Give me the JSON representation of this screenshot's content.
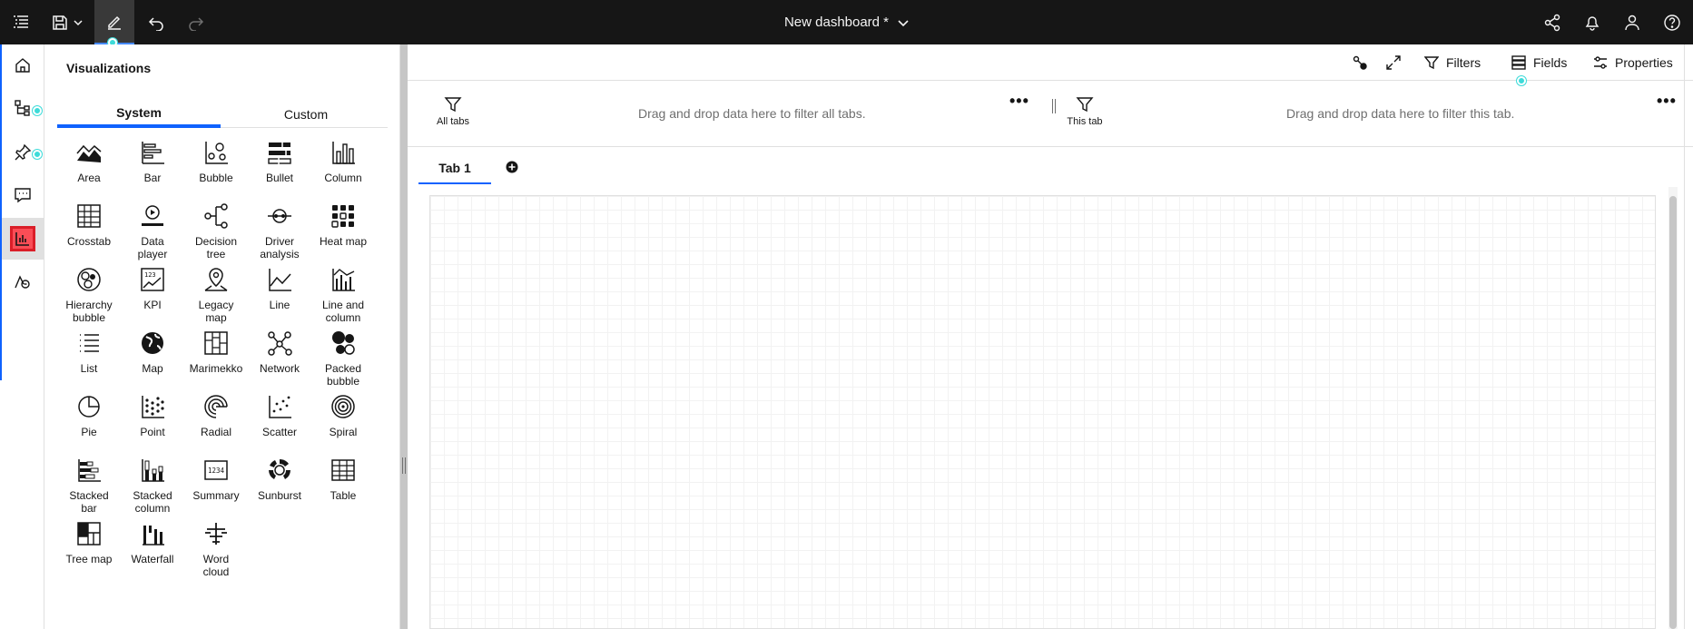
{
  "colors": {
    "topbar": "#161616",
    "accent": "#0f62fe",
    "teal_dot": "#3ddbd9",
    "highlight": "#da1e28"
  },
  "header": {
    "title": "New dashboard *",
    "icons": [
      "menu-icon",
      "save-icon",
      "chevron-down-icon",
      "edit-icon",
      "undo-icon",
      "redo-icon",
      "share-icon",
      "notification-icon",
      "user-icon",
      "help-icon"
    ]
  },
  "rail": {
    "items": [
      "home-icon",
      "data-sources-icon",
      "pin-icon",
      "comments-icon",
      "visualizations-icon",
      "assistant-icon"
    ]
  },
  "panel": {
    "title": "Visualizations",
    "tabs": [
      "System",
      "Custom"
    ],
    "active_tab": "System",
    "items": [
      [
        "Area"
      ],
      [
        "Bar"
      ],
      [
        "Bubble"
      ],
      [
        "Bullet"
      ],
      [
        "Column"
      ],
      [
        "Crosstab"
      ],
      [
        "Data",
        "player"
      ],
      [
        "Decision",
        "tree"
      ],
      [
        "Driver",
        "analysis"
      ],
      [
        "Heat map"
      ],
      [
        "Hierarchy",
        "bubble"
      ],
      [
        "KPI"
      ],
      [
        "Legacy",
        "map"
      ],
      [
        "Line"
      ],
      [
        "Line and",
        "column"
      ],
      [
        "List"
      ],
      [
        "Map"
      ],
      [
        "Marimekko"
      ],
      [
        "Network"
      ],
      [
        "Packed",
        "bubble"
      ],
      [
        "Pie"
      ],
      [
        "Point"
      ],
      [
        "Radial"
      ],
      [
        "Scatter"
      ],
      [
        "Spiral"
      ],
      [
        "Stacked",
        "bar"
      ],
      [
        "Stacked",
        "column"
      ],
      [
        "Summary"
      ],
      [
        "Sunburst"
      ],
      [
        "Table"
      ],
      [
        "Tree map"
      ],
      [
        "Waterfall"
      ],
      [
        "Word",
        "cloud"
      ]
    ]
  },
  "toolbar": {
    "filters_label": "Filters",
    "fields_label": "Fields",
    "properties_label": "Properties"
  },
  "filters": {
    "all_tabs_label": "All tabs",
    "all_tabs_hint": "Drag and drop data here to filter all tabs.",
    "this_tab_label": "This tab",
    "this_tab_hint": "Drag and drop data here to filter this tab.",
    "more": "•••"
  },
  "tabs": [
    {
      "label": "Tab 1"
    }
  ]
}
